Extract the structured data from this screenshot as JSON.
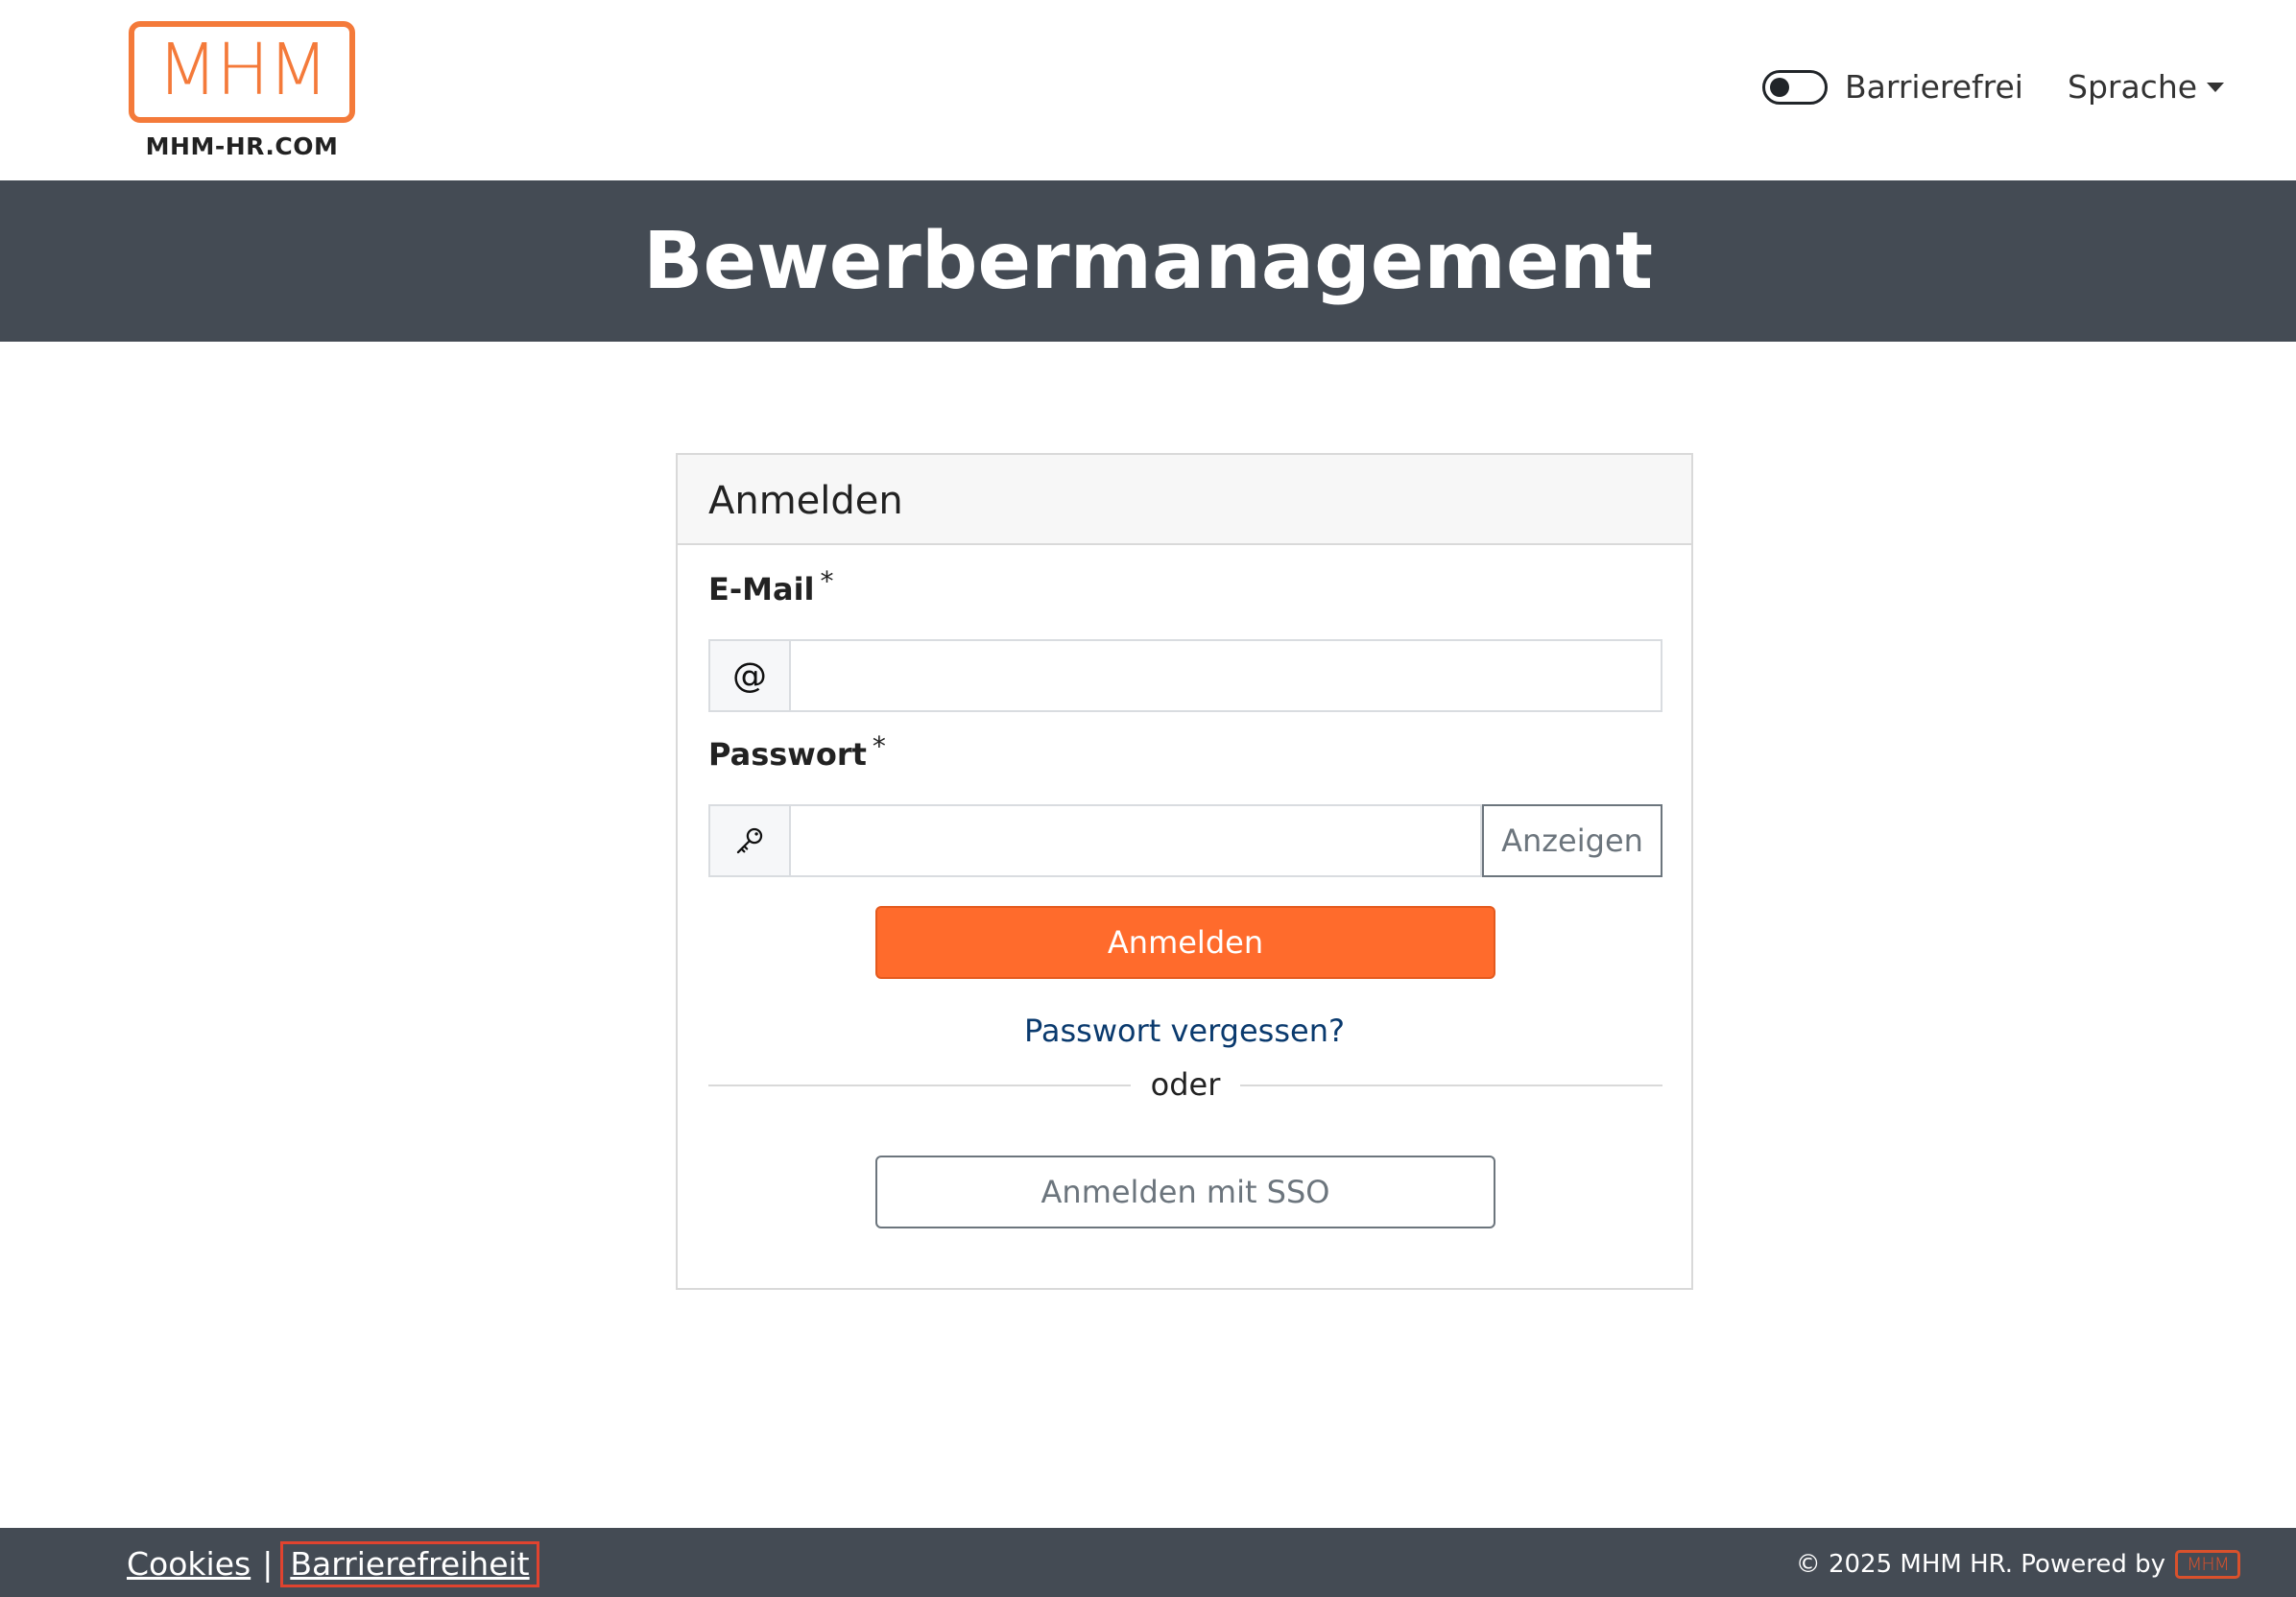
{
  "header": {
    "logo": {
      "letters": "MHM",
      "caption": "MHM-HR.COM"
    },
    "accessibility_toggle": {
      "label": "Barrierefrei",
      "enabled": false
    },
    "language": {
      "label": "Sprache"
    }
  },
  "banner": {
    "title": "Bewerbermanagement"
  },
  "login": {
    "title": "Anmelden",
    "email": {
      "label": "E-Mail",
      "required_mark": "*",
      "icon": "at-sign-icon",
      "icon_glyph": "@",
      "value": "",
      "placeholder": ""
    },
    "password": {
      "label": "Passwort",
      "required_mark": "*",
      "icon": "key-icon",
      "value": "",
      "placeholder": "",
      "show_label": "Anzeigen"
    },
    "submit_label": "Anmelden",
    "forgot_label": "Passwort vergessen?",
    "divider_label": "oder",
    "sso_label": "Anmelden mit SSO"
  },
  "footer": {
    "links": [
      {
        "label": "Cookies"
      },
      {
        "label": "Barrierefreiheit",
        "focused": true
      }
    ],
    "separator": "|",
    "copyright": "© 2025 MHM HR. Powered by",
    "powered_logo": "MHM"
  },
  "colors": {
    "brand_orange": "#ff6b2c",
    "logo_orange": "#f47a3a",
    "banner_bg": "#444b54",
    "link_blue": "#0a3a6e",
    "focus_outline": "#e0432f"
  }
}
